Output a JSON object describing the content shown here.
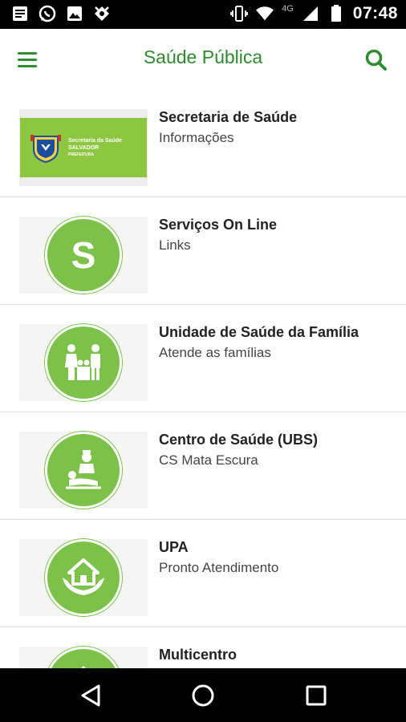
{
  "status_bar": {
    "time": "07:48",
    "network": "4G",
    "icons": [
      "message-icon",
      "whatsapp-icon",
      "image-icon",
      "app-icon",
      "vibrate-icon",
      "wifi-icon",
      "signal-icon",
      "battery-icon"
    ]
  },
  "app_bar": {
    "title": "Saúde Pública",
    "menu_icon": "hamburger-menu-icon",
    "search_icon": "search-icon",
    "accent_color": "#2e8b2e"
  },
  "banner": {
    "line1": "Secretaria da Saúde",
    "line2": "SALVADOR",
    "line3": "PREFEITURA"
  },
  "items": [
    {
      "title": "Secretaria de Saúde",
      "subtitle": "Informações",
      "icon": "secretaria-banner-logo"
    },
    {
      "title": "Serviços On Line",
      "subtitle": "Links",
      "icon": "letter-s-icon",
      "letter": "S"
    },
    {
      "title": "Unidade de Saúde da Família",
      "subtitle": "Atende as famílias",
      "icon": "family-icon"
    },
    {
      "title": "Centro de Saúde (UBS)",
      "subtitle": "CS Mata Escura",
      "icon": "doctor-patient-icon"
    },
    {
      "title": "UPA",
      "subtitle": "Pronto Atendimento",
      "icon": "house-in-hands-icon"
    },
    {
      "title": "Multicentro",
      "subtitle": "",
      "icon": "multicentro-icon"
    }
  ],
  "icon_color": "#7cc24a",
  "nav_bar": {
    "icons": [
      "back-icon",
      "home-icon",
      "recents-icon"
    ]
  }
}
